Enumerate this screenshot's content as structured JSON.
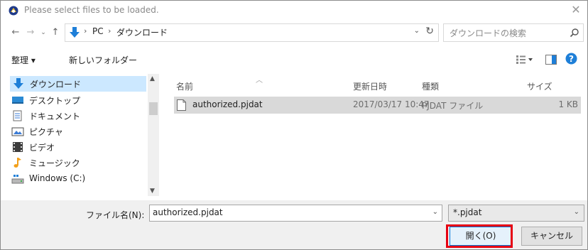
{
  "window": {
    "title": "Please select files to be loaded.",
    "close_glyph": "✕"
  },
  "address": {
    "breadcrumb": [
      "PC",
      "ダウンロード"
    ],
    "search_placeholder": "ダウンロードの検索"
  },
  "toolbar": {
    "organize_label": "整理 ▾",
    "new_folder_label": "新しいフォルダー"
  },
  "nav_pane": {
    "items": [
      {
        "label": "ダウンロード",
        "icon": "download-arrow-icon",
        "selected": true
      },
      {
        "label": "デスクトップ",
        "icon": "desktop-icon"
      },
      {
        "label": "ドキュメント",
        "icon": "documents-icon"
      },
      {
        "label": "ピクチャ",
        "icon": "pictures-icon"
      },
      {
        "label": "ビデオ",
        "icon": "video-icon"
      },
      {
        "label": "ミュージック",
        "icon": "music-note-icon"
      },
      {
        "label": "Windows (C:)",
        "icon": "drive-icon"
      }
    ]
  },
  "file_list": {
    "columns": [
      "名前",
      "更新日時",
      "種類",
      "サイズ"
    ],
    "rows": [
      {
        "name": "authorized.pjdat",
        "modified": "2017/03/17 10:47",
        "type": "PJDAT ファイル",
        "size": "1 KB",
        "selected": true
      }
    ]
  },
  "footer": {
    "filename_label": "ファイル名(N):",
    "filename_value": "authorized.pjdat",
    "filter_value": "*.pjdat",
    "open_label": "開く(O)",
    "cancel_label": "キャンセル"
  },
  "colors": {
    "selection_blue": "#cce8ff",
    "row_selected_gray": "#d9d9d9",
    "highlight_red": "#e60012",
    "accent_blue": "#0078d7"
  }
}
